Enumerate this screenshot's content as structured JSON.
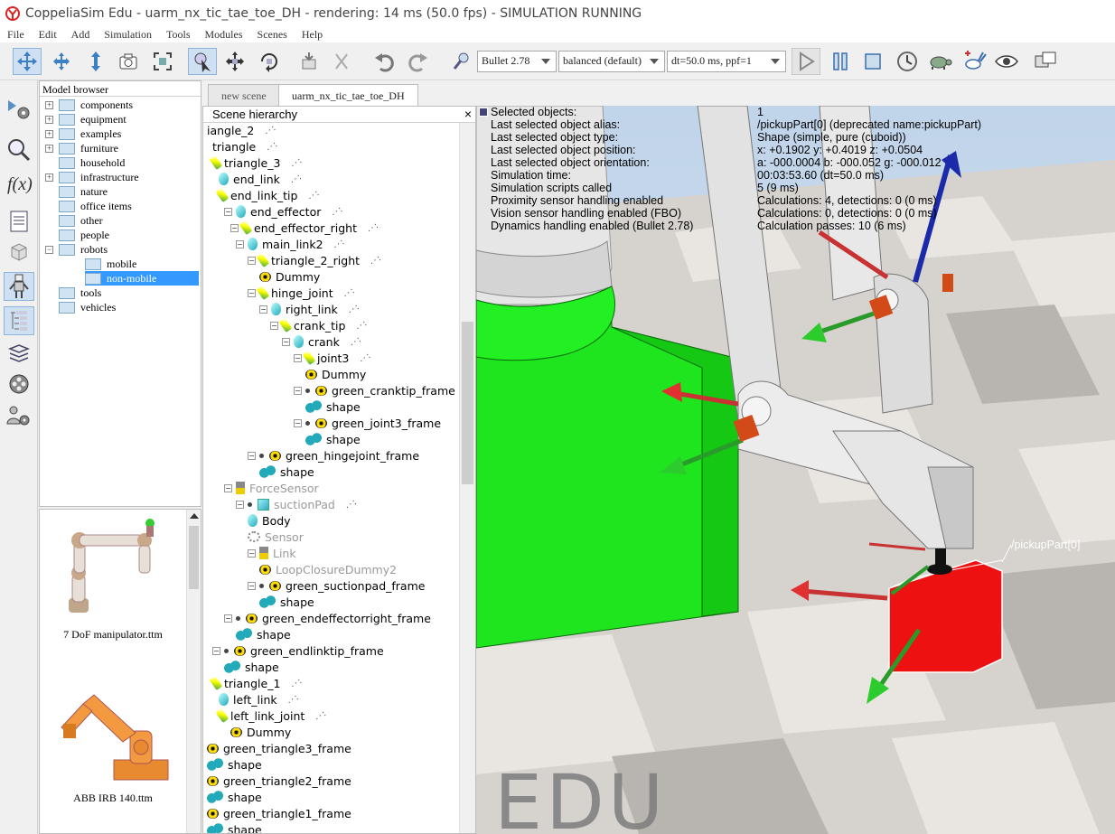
{
  "window": {
    "title": "CoppeliaSim Edu - uarm_nx_tic_tae_toe_DH - rendering: 14 ms (50.0 fps) - SIMULATION RUNNING"
  },
  "menu": [
    "File",
    "Edit",
    "Add",
    "Simulation",
    "Tools",
    "Modules",
    "Scenes",
    "Help"
  ],
  "toolbar": {
    "engine": "Bullet 2.78",
    "accuracy": "balanced (default)",
    "timestep": "dt=50.0 ms, ppf=1"
  },
  "model_browser": {
    "title": "Model browser",
    "items": [
      {
        "label": "components",
        "level": 0,
        "expandable": true
      },
      {
        "label": "equipment",
        "level": 0,
        "expandable": true
      },
      {
        "label": "examples",
        "level": 0,
        "expandable": true
      },
      {
        "label": "furniture",
        "level": 0,
        "expandable": true
      },
      {
        "label": "household",
        "level": 0,
        "expandable": false
      },
      {
        "label": "infrastructure",
        "level": 0,
        "expandable": true
      },
      {
        "label": "nature",
        "level": 0,
        "expandable": false
      },
      {
        "label": "office items",
        "level": 0,
        "expandable": false
      },
      {
        "label": "other",
        "level": 0,
        "expandable": false
      },
      {
        "label": "people",
        "level": 0,
        "expandable": false
      },
      {
        "label": "robots",
        "level": 0,
        "expandable": true,
        "expanded": true
      },
      {
        "label": "mobile",
        "level": 1,
        "expandable": false
      },
      {
        "label": "non-mobile",
        "level": 1,
        "expandable": false,
        "selected": true
      },
      {
        "label": "tools",
        "level": 0,
        "expandable": false
      },
      {
        "label": "vehicles",
        "level": 0,
        "expandable": false
      }
    ],
    "thumbnails": [
      {
        "label": "7 DoF manipulator.ttm"
      },
      {
        "label": "ABB IRB 140.ttm"
      }
    ]
  },
  "tabs": [
    {
      "label": "new scene",
      "active": false
    },
    {
      "label": "uarm_nx_tic_tae_toe_DH",
      "active": true
    }
  ],
  "scene_hierarchy": {
    "title": "Scene hierarchy",
    "close": "×",
    "nodes": [
      {
        "label": "iangle_2",
        "icon": "none",
        "script": true
      },
      {
        "label": "triangle",
        "icon": "none",
        "script": true
      },
      {
        "label": "triangle_3",
        "icon": "joint",
        "script": true
      },
      {
        "label": "end_link",
        "icon": "shape",
        "script": true
      },
      {
        "label": "end_link_tip",
        "icon": "joint",
        "script": true
      },
      {
        "label": "end_effector",
        "icon": "shape",
        "script": true
      },
      {
        "label": "end_effector_right",
        "icon": "joint",
        "script": true
      },
      {
        "label": "main_link2",
        "icon": "shape",
        "script": true
      },
      {
        "label": "triangle_2_right",
        "icon": "joint",
        "script": true
      },
      {
        "label": "Dummy",
        "icon": "dummy",
        "script": false
      },
      {
        "label": "hinge_joint",
        "icon": "joint",
        "script": true
      },
      {
        "label": "right_link",
        "icon": "shape",
        "script": true
      },
      {
        "label": "crank_tip",
        "icon": "joint",
        "script": true
      },
      {
        "label": "crank",
        "icon": "shape",
        "script": true
      },
      {
        "label": "joint3",
        "icon": "joint",
        "script": true
      },
      {
        "label": "Dummy",
        "icon": "dummy",
        "script": false
      },
      {
        "label": "green_cranktip_frame",
        "icon": "dummy",
        "script": false
      },
      {
        "label": "shape",
        "icon": "multi",
        "script": false
      },
      {
        "label": "green_joint3_frame",
        "icon": "dummy",
        "script": false
      },
      {
        "label": "shape",
        "icon": "multi",
        "script": false
      },
      {
        "label": "green_hingejoint_frame",
        "icon": "dummy",
        "script": false
      },
      {
        "label": "shape",
        "icon": "multi",
        "script": false
      },
      {
        "label": "ForceSensor",
        "icon": "force",
        "script": false,
        "dim": true
      },
      {
        "label": "suctionPad",
        "icon": "cube",
        "script": true,
        "dim": true
      },
      {
        "label": "Body",
        "icon": "shape",
        "script": false
      },
      {
        "label": "Sensor",
        "icon": "sensor",
        "script": false,
        "dim": true
      },
      {
        "label": "Link",
        "icon": "force",
        "script": false,
        "dim": true
      },
      {
        "label": "LoopClosureDummy2",
        "icon": "dummy",
        "script": false,
        "dim": true
      },
      {
        "label": "green_suctionpad_frame",
        "icon": "dummy",
        "script": false
      },
      {
        "label": "shape",
        "icon": "multi",
        "script": false
      },
      {
        "label": "green_endeffectorright_frame",
        "icon": "dummy",
        "script": false
      },
      {
        "label": "shape",
        "icon": "multi",
        "script": false
      },
      {
        "label": "green_endlinktip_frame",
        "icon": "dummy",
        "script": false
      },
      {
        "label": "shape",
        "icon": "multi",
        "script": false
      },
      {
        "label": "triangle_1",
        "icon": "joint",
        "script": true
      },
      {
        "label": "left_link",
        "icon": "shape",
        "script": true
      },
      {
        "label": "left_link_joint",
        "icon": "joint",
        "script": true
      },
      {
        "label": "Dummy",
        "icon": "dummy",
        "script": false
      },
      {
        "label": "green_triangle3_frame",
        "icon": "dummy",
        "script": false
      },
      {
        "label": "shape",
        "icon": "multi",
        "script": false
      },
      {
        "label": "green_triangle2_frame",
        "icon": "dummy",
        "script": false
      },
      {
        "label": "shape",
        "icon": "multi",
        "script": false
      },
      {
        "label": "green_triangle1_frame",
        "icon": "dummy",
        "script": false
      },
      {
        "label": "shape",
        "icon": "multi",
        "script": false
      }
    ]
  },
  "info": [
    {
      "k": "Selected objects:",
      "v": "1"
    },
    {
      "k": "Last selected object alias:",
      "v": "/pickupPart[0]   (deprecated name:pickupPart)"
    },
    {
      "k": "Last selected object type:",
      "v": "Shape (simple, pure (cuboid))"
    },
    {
      "k": "Last selected object position:",
      "v": "x: +0.1902    y: +0.4019    z: +0.0504"
    },
    {
      "k": "Last selected object orientation:",
      "v": "a: -000.0004    b: -000.052    g: -000.012"
    },
    {
      "k": "Simulation time:",
      "v": "00:03:53.60 (dt=50.0 ms)"
    },
    {
      "k": "Simulation scripts called",
      "v": "5 (9 ms)"
    },
    {
      "k": "Proximity sensor handling enabled",
      "v": "Calculations: 4, detections: 0 (0 ms)"
    },
    {
      "k": "Vision sensor handling enabled (FBO)",
      "v": "Calculations: 0, detections: 0 (0 ms)"
    },
    {
      "k": "Dynamics handling enabled (Bullet 2.78)",
      "v": "Calculation passes: 10 (6 ms)"
    }
  ],
  "viewport": {
    "object_label": "/pickupPart[0]",
    "watermark": "EDU"
  }
}
